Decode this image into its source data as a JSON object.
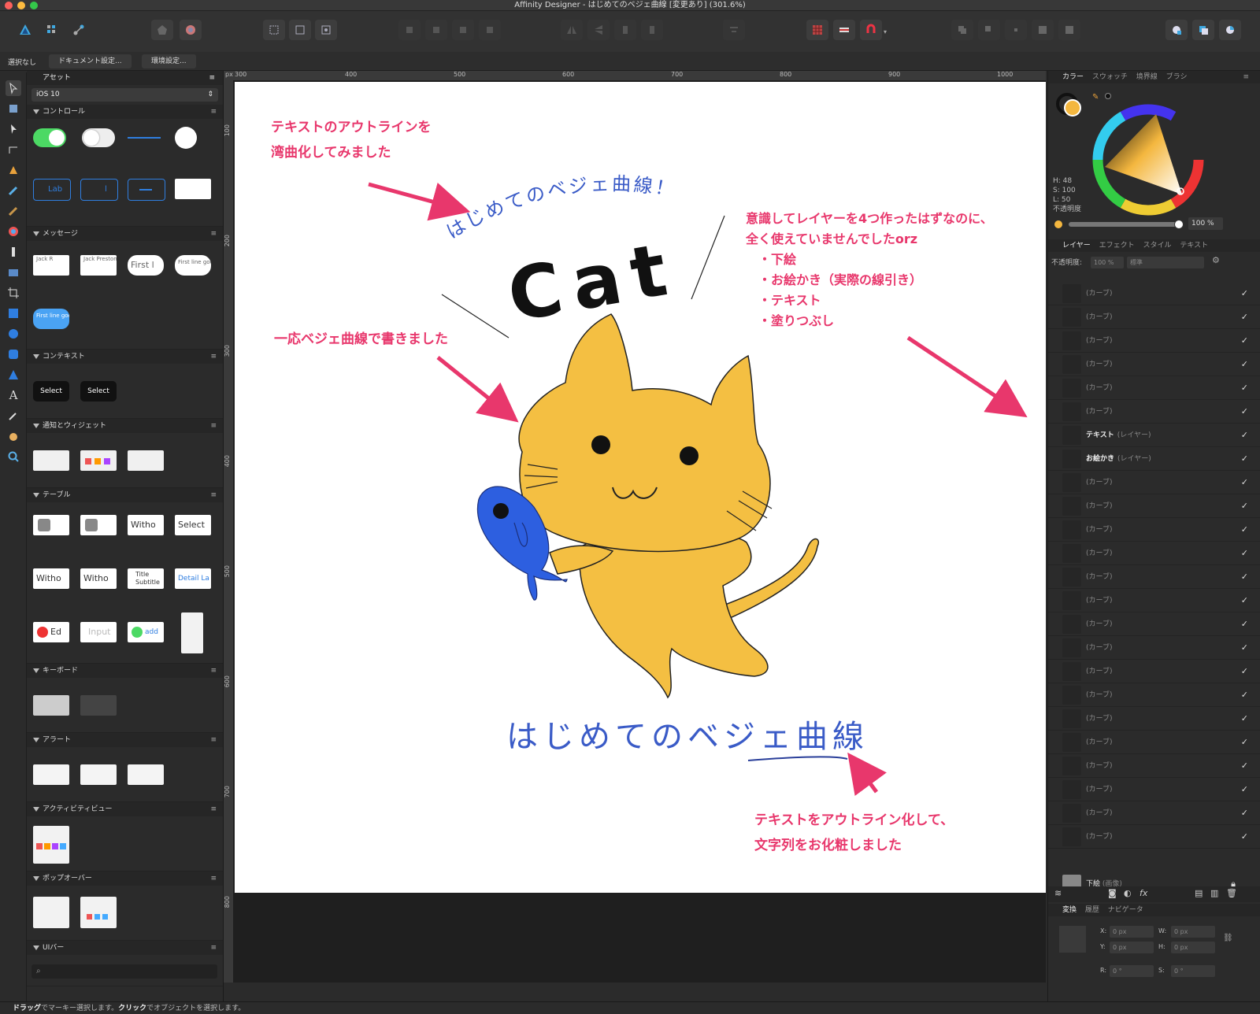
{
  "window": {
    "title": "Affinity Designer - はじめてのベジェ曲線 [変更あり] (301.6%)"
  },
  "context_bar": {
    "selection": "選択なし",
    "doc_settings": "ドキュメント設定...",
    "preferences": "環境設定..."
  },
  "assets_panel": {
    "tab": "アセット",
    "set": "iOS 10",
    "categories": {
      "controls": "コントロール",
      "messages": "メッセージ",
      "context": "コンテキスト",
      "notifications": "通知とウィジェット",
      "table": "テーブル",
      "keyboard": "キーボード",
      "alert": "アラート",
      "activity": "アクティビティビュー",
      "popover": "ポップオーバー",
      "uibar": "UIバー"
    },
    "thumb_text": {
      "control_label_1": "Lab",
      "control_label_2": "l",
      "msg_1": "Jack R",
      "msg_2": "Jack Preston",
      "msg_3": "First l",
      "msg_4": "First line goe second line",
      "msg_5": "First line goe second line",
      "select_1": "Select",
      "select_2": "Select",
      "table_1": "Witho",
      "table_2": "Select",
      "table_3": "Witho",
      "table_4": "Witho",
      "table_5": "Title Subtitle",
      "table_6": "Detail La",
      "table_7": "Ed",
      "table_8": "Input",
      "table_9": "add"
    }
  },
  "rulers": {
    "unit": "px",
    "h_ticks": [
      "300",
      "400",
      "500",
      "600",
      "700",
      "800",
      "900",
      "1000"
    ],
    "v_ticks": [
      "100",
      "200",
      "300",
      "400",
      "500",
      "600",
      "700",
      "800"
    ]
  },
  "artboard": {
    "ann_top": "テキストのアウトラインを\n湾曲化してみました",
    "ann_left": "一応ベジェ曲線で書きました",
    "ann_right": "意識してレイヤーを4つ作ったはずなのに、\n全く使えていませんでしたorz\n　・下絵\n　・お絵かき（実際の線引き）\n　・テキスト\n　・塗りつぶし",
    "ann_bottom": "テキストをアウトライン化して、\n文字列をお化粧しました",
    "curved_text": "はじめてのベジェ曲線！",
    "cat_text": "Cat",
    "outline_text": "はじめてのベジェ曲線"
  },
  "color_panel": {
    "tabs": [
      "カラー",
      "スウォッチ",
      "境界線",
      "ブラシ"
    ],
    "h": "H: 48",
    "s": "S: 100",
    "l": "L: 50",
    "opacity_label": "不透明度",
    "opacity_value": "100 %",
    "accent": "#f4b73f"
  },
  "layers_panel": {
    "tabs": [
      "レイヤー",
      "エフェクト",
      "スタイル",
      "テキスト"
    ],
    "opacity_label": "不透明度:",
    "opacity_value": "100 %",
    "blend": "標準",
    "items": [
      {
        "name": "(カーブ)"
      },
      {
        "name": "(カーブ)"
      },
      {
        "name": "(カーブ)"
      },
      {
        "name": "(カーブ)"
      },
      {
        "name": "(カーブ)"
      },
      {
        "name": "(カーブ)"
      },
      {
        "name": "テキスト",
        "type": "(レイヤー)"
      },
      {
        "name": "お絵かき",
        "type": "(レイヤー)"
      },
      {
        "name": "(カーブ)"
      },
      {
        "name": "(カーブ)"
      },
      {
        "name": "(カーブ)"
      },
      {
        "name": "(カーブ)"
      },
      {
        "name": "(カーブ)"
      },
      {
        "name": "(カーブ)"
      },
      {
        "name": "(カーブ)"
      },
      {
        "name": "(カーブ)"
      },
      {
        "name": "(カーブ)"
      },
      {
        "name": "(カーブ)"
      },
      {
        "name": "(カーブ)"
      },
      {
        "name": "(カーブ)"
      },
      {
        "name": "(カーブ)"
      },
      {
        "name": "(カーブ)"
      },
      {
        "name": "(カーブ)"
      },
      {
        "name": "(カーブ)"
      }
    ],
    "bottom_layer": {
      "name": "下絵",
      "type": "(画像)"
    }
  },
  "transform_panel": {
    "tabs": [
      "変換",
      "履歴",
      "ナビゲータ"
    ],
    "x": "0 px",
    "y": "0 px",
    "w": "0 px",
    "h": "0 px",
    "r": "0 °",
    "s": "0 °",
    "labels": {
      "x": "X:",
      "y": "Y:",
      "w": "W:",
      "h": "H:",
      "r": "R:",
      "s": "S:"
    }
  },
  "status_bar": {
    "drag": "ドラッグ",
    "drag_text": "でマーキー選択します。",
    "click": "クリック",
    "click_text": "でオブジェクトを選択します。"
  },
  "colors": {
    "annotation": "#e8376c",
    "cat": "#f4bf42",
    "fish": "#2d5fe0",
    "outline_text": "#3a5bc7"
  }
}
